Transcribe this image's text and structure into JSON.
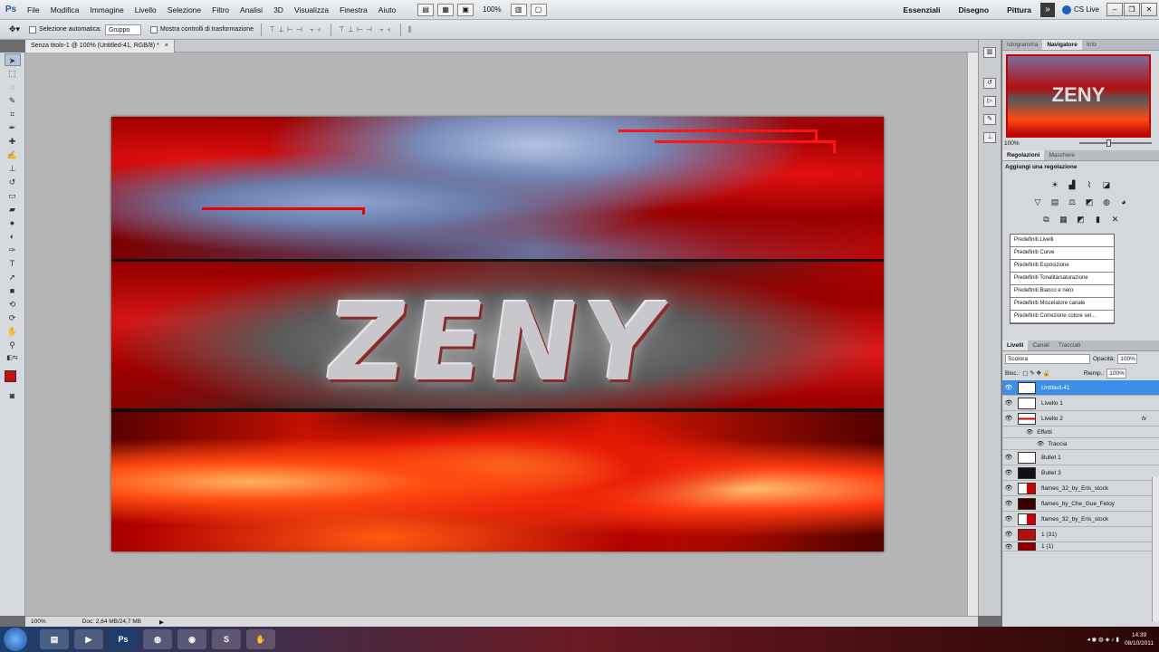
{
  "app": {
    "logo": "Ps"
  },
  "menu": [
    "File",
    "Modifica",
    "Immagine",
    "Livello",
    "Selezione",
    "Filtro",
    "Analisi",
    "3D",
    "Visualizza",
    "Finestra",
    "Aiuto"
  ],
  "toolbar": {
    "zoom": "100%"
  },
  "workspaces": [
    "Essenziali",
    "Disegno",
    "Pittura"
  ],
  "cs_live": "CS Live",
  "options": {
    "auto_select_label": "Selezione automatica:",
    "auto_select_value": "Gruppo",
    "transform_label": "Mostra controlli di trasformazione"
  },
  "document": {
    "tab": "Senza titolo-1 @ 100% (Untitled-41, RGB/8) *",
    "close": "×",
    "zoom": "100%",
    "doc_info": "Doc: 2,64 MB/24,7 MB",
    "artwork_text": "ZENY"
  },
  "navigator": {
    "tabs": [
      "Istogramma",
      "Navigatore",
      "Info"
    ],
    "preview_text": "ZENY",
    "zoom": "100%"
  },
  "adjustments": {
    "tabs": [
      "Regolazioni",
      "Maschere"
    ],
    "title": "Aggiungi una regolazione",
    "presets": [
      "Predefiniti Livelli",
      "Predefiniti Curve",
      "Predefiniti Esposizione",
      "Predefiniti Tonalità/saturazione",
      "Predefiniti Bianco e nero",
      "Predefiniti Miscelatore canale",
      "Predefiniti Correzione colore sel..."
    ]
  },
  "layers_panel": {
    "tabs": [
      "Livelli",
      "Canali",
      "Tracciati"
    ],
    "blend_mode": "Scolora",
    "opacity_label": "Opacità:",
    "opacity": "100%",
    "lock_label": "Bloc.:",
    "fill_label": "Riemp.:",
    "fill": "100%",
    "layers": [
      {
        "name": "Untitled-41",
        "selected": true
      },
      {
        "name": "Livello 1"
      },
      {
        "name": "Livello 2",
        "fx": "fx"
      },
      {
        "name": "Effetti",
        "sub": true
      },
      {
        "name": "Traccia",
        "sub": true
      },
      {
        "name": "Bullet 1"
      },
      {
        "name": "Bullet 3"
      },
      {
        "name": "flames_32_by_Eris_stock"
      },
      {
        "name": "flames_by_Che_Gue_Fetoy"
      },
      {
        "name": "flames_32_by_Eris_stock"
      },
      {
        "name": "1 (31)"
      },
      {
        "name": "1 (1)"
      }
    ]
  },
  "taskbar": {
    "apps": [
      "",
      "",
      "",
      "Ps",
      "",
      "",
      "",
      ""
    ],
    "time": "14:39",
    "date": "08/10/2011"
  },
  "colors": {
    "foreground": "#c41212",
    "selection": "#3d8ee6"
  }
}
